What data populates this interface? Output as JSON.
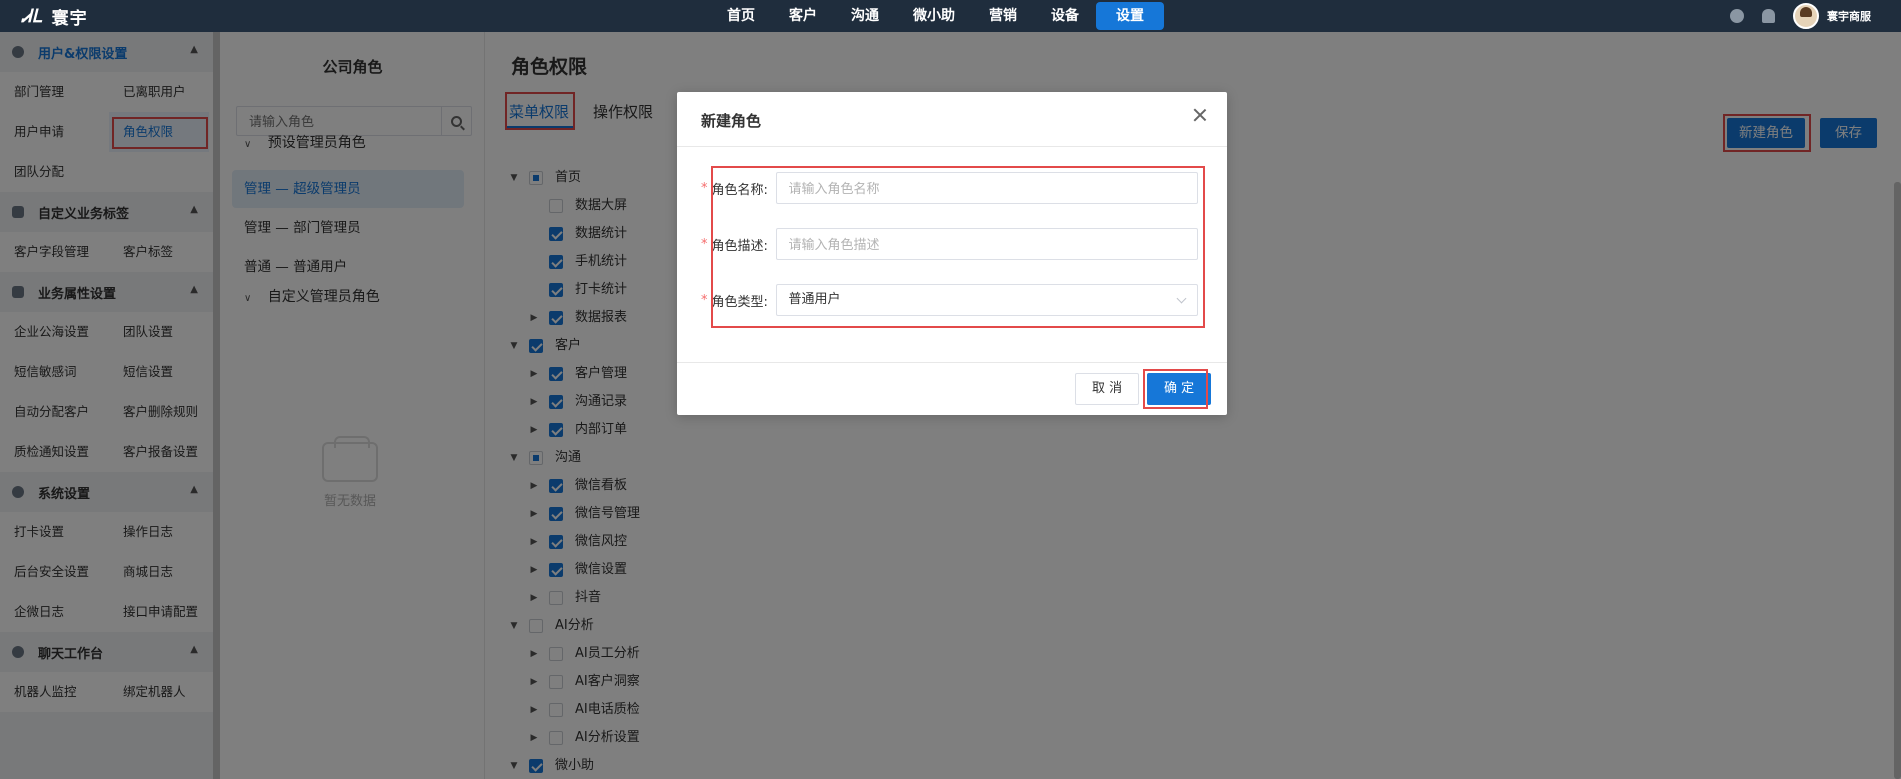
{
  "brand": {
    "mark": "ᏗᏞ",
    "name": "寰宇"
  },
  "nav": {
    "items": [
      "首页",
      "客户",
      "沟通",
      "微小助",
      "营销",
      "设备",
      "设置"
    ],
    "active_index": 6
  },
  "user": {
    "name": "寰宇商服"
  },
  "sidebar": {
    "sections": [
      {
        "title": "用户&权限设置",
        "links": [
          "部门管理",
          "已离职用户",
          "用户申请",
          "角色权限",
          "团队分配"
        ]
      },
      {
        "title": "自定义业务标签",
        "links": [
          "客户字段管理",
          "客户标签"
        ]
      },
      {
        "title": "业务属性设置",
        "links": [
          "企业公海设置",
          "团队设置",
          "短信敏感词",
          "短信设置",
          "自动分配客户",
          "客户删除规则",
          "质检通知设置",
          "客户报备设置"
        ]
      },
      {
        "title": "系统设置",
        "links": [
          "打卡设置",
          "操作日志",
          "后台安全设置",
          "商城日志",
          "企微日志",
          "接口申请配置"
        ]
      },
      {
        "title": "聊天工作台",
        "links": [
          "机器人监控",
          "绑定机器人"
        ]
      }
    ]
  },
  "roles": {
    "title": "公司角色",
    "search_placeholder": "请输入角色",
    "preset_group": "预设管理员角色",
    "preset_items": [
      "管理 — 超级管理员",
      "管理 — 部门管理员",
      "普通 — 普通用户"
    ],
    "custom_group": "自定义管理员角色",
    "empty_text": "暂无数据"
  },
  "main": {
    "title": "角色权限",
    "tabs": [
      "菜单权限",
      "操作权限"
    ],
    "new_role_button": "新建角色",
    "save_button": "保存",
    "tree": [
      {
        "label": "首页",
        "level": 0,
        "expand": "down",
        "state": "partial"
      },
      {
        "label": "数据大屏",
        "level": 1,
        "expand": "",
        "state": "none"
      },
      {
        "label": "数据统计",
        "level": 1,
        "expand": "",
        "state": "checked"
      },
      {
        "label": "手机统计",
        "level": 1,
        "expand": "",
        "state": "checked"
      },
      {
        "label": "打卡统计",
        "level": 1,
        "expand": "",
        "state": "checked"
      },
      {
        "label": "数据报表",
        "level": 1,
        "expand": "right",
        "state": "checked"
      },
      {
        "label": "客户",
        "level": 0,
        "expand": "down",
        "state": "checked"
      },
      {
        "label": "客户管理",
        "level": 1,
        "expand": "right",
        "state": "checked"
      },
      {
        "label": "沟通记录",
        "level": 1,
        "expand": "right",
        "state": "checked"
      },
      {
        "label": "内部订单",
        "level": 1,
        "expand": "right",
        "state": "checked"
      },
      {
        "label": "沟通",
        "level": 0,
        "expand": "down",
        "state": "partial"
      },
      {
        "label": "微信看板",
        "level": 1,
        "expand": "right",
        "state": "checked"
      },
      {
        "label": "微信号管理",
        "level": 1,
        "expand": "right",
        "state": "checked"
      },
      {
        "label": "微信风控",
        "level": 1,
        "expand": "right",
        "state": "checked"
      },
      {
        "label": "微信设置",
        "level": 1,
        "expand": "right",
        "state": "checked"
      },
      {
        "label": "抖音",
        "level": 1,
        "expand": "right",
        "state": "none"
      },
      {
        "label": "AI分析",
        "level": 0,
        "expand": "down",
        "state": "none"
      },
      {
        "label": "AI员工分析",
        "level": 1,
        "expand": "right",
        "state": "none"
      },
      {
        "label": "AI客户洞察",
        "level": 1,
        "expand": "right",
        "state": "none"
      },
      {
        "label": "AI电话质检",
        "level": 1,
        "expand": "right",
        "state": "none"
      },
      {
        "label": "AI分析设置",
        "level": 1,
        "expand": "right",
        "state": "none"
      },
      {
        "label": "微小助",
        "level": 0,
        "expand": "down",
        "state": "checked"
      }
    ]
  },
  "dialog": {
    "title": "新建角色",
    "name_label": "角色名称:",
    "name_placeholder": "请输入角色名称",
    "desc_label": "角色描述:",
    "desc_placeholder": "请输入角色描述",
    "type_label": "角色类型:",
    "type_value": "普通用户",
    "cancel": "取 消",
    "confirm": "确 定"
  }
}
